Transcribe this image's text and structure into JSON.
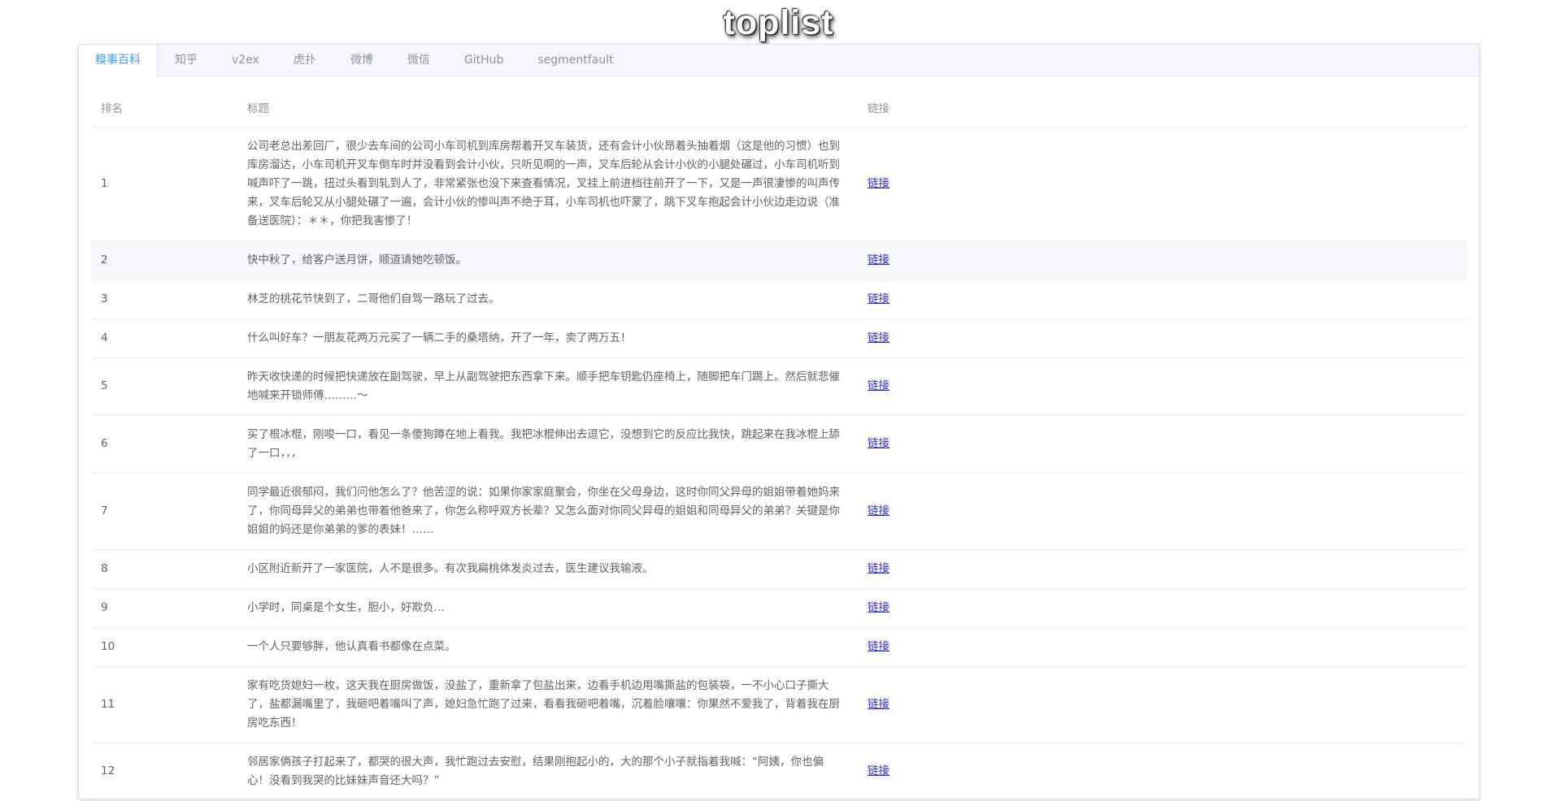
{
  "app": {
    "title": "toplist"
  },
  "tabs": [
    {
      "label": "糗事百科",
      "active": true
    },
    {
      "label": "知乎",
      "active": false
    },
    {
      "label": "v2ex",
      "active": false
    },
    {
      "label": "虎扑",
      "active": false
    },
    {
      "label": "微博",
      "active": false
    },
    {
      "label": "微信",
      "active": false
    },
    {
      "label": "GitHub",
      "active": false
    },
    {
      "label": "segmentfault",
      "active": false
    }
  ],
  "table": {
    "headers": {
      "rank": "排名",
      "title": "标题",
      "link": "链接"
    },
    "rows": [
      {
        "rank": "1",
        "title": "公司老总出差回厂，很少去车间的公司小车司机到库房帮着开叉车装货，还有会计小伙昂着头抽着烟（这是他的习惯）也到库房溜达，小车司机开叉车倒车时并没看到会计小伙，只听见啊的一声，叉车后轮从会计小伙的小腿处碾过，小车司机听到喊声吓了一跳，扭过头看到轧到人了，非常紧张也没下来查看情况，叉挂上前进档往前开了一下，又是一声很凄惨的叫声传来，叉车后轮又从小腿处碾了一遍，会计小伙的惨叫声不绝于耳，小车司机也吓蒙了，跳下叉车抱起会计小伙边走边说（准备送医院）：＊＊，你把我害惨了！",
        "link": "链接"
      },
      {
        "rank": "2",
        "title": "快中秋了，给客户送月饼，顺道请她吃顿饭。",
        "link": "链接"
      },
      {
        "rank": "3",
        "title": "林芝的桃花节快到了，二哥他们自驾一路玩了过去。",
        "link": "链接"
      },
      {
        "rank": "4",
        "title": "什么叫好车？一朋友花两万元买了一辆二手的桑塔纳，开了一年，卖了两万五！",
        "link": "链接"
      },
      {
        "rank": "5",
        "title": "昨天收快递的时候把快递放在副驾驶，早上从副驾驶把东西拿下来。顺手把车钥匙仍座椅上，随脚把车门踢上。然后就悲催地喊来开锁师傅………～",
        "link": "链接"
      },
      {
        "rank": "6",
        "title": "买了根冰棍，刚唆一口，看见一条傻狗蹲在地上看我。我把冰棍伸出去逗它，没想到它的反应比我快，跳起来在我冰棍上舔了一口，，，",
        "link": "链接"
      },
      {
        "rank": "7",
        "title": "同学最近很郁闷，我们问他怎么了？他苦涩的说：如果你家家庭聚会，你坐在父母身边，这时你同父异母的姐姐带着她妈来了，你同母异父的弟弟也带着他爸来了，你怎么称呼双方长辈？又怎么面对你同父异母的姐姐和同母异父的弟弟？关键是你姐姐的妈还是你弟弟的爹的表妹！……",
        "link": "链接"
      },
      {
        "rank": "8",
        "title": "小区附近新开了一家医院，人不是很多。有次我扁桃体发炎过去，医生建议我输液。",
        "link": "链接"
      },
      {
        "rank": "9",
        "title": "小学时，同桌是个女生，胆小，好欺负…",
        "link": "链接"
      },
      {
        "rank": "10",
        "title": "一个人只要够胖，他认真看书都像在点菜。",
        "link": "链接"
      },
      {
        "rank": "11",
        "title": "家有吃货媳妇一枚，这天我在厨房做饭，没盐了，重新拿了包盐出来，边看手机边用嘴撕盐的包装袋，一不小心口子撕大了，盐都漏嘴里了，我砸吧着嘴叫了声，媳妇急忙跑了过来，看看我砸吧着嘴，沉着脸嚷嚷：你果然不爱我了，背着我在厨房吃东西！",
        "link": "链接"
      },
      {
        "rank": "12",
        "title": "邻居家俩孩子打起来了，都哭的很大声，我忙跑过去安慰，结果刚抱起小的，大的那个小子就指着我喊：“阿姨，你也偏心！没看到我哭的比妹妹声音还大吗？”",
        "link": "链接"
      }
    ]
  }
}
